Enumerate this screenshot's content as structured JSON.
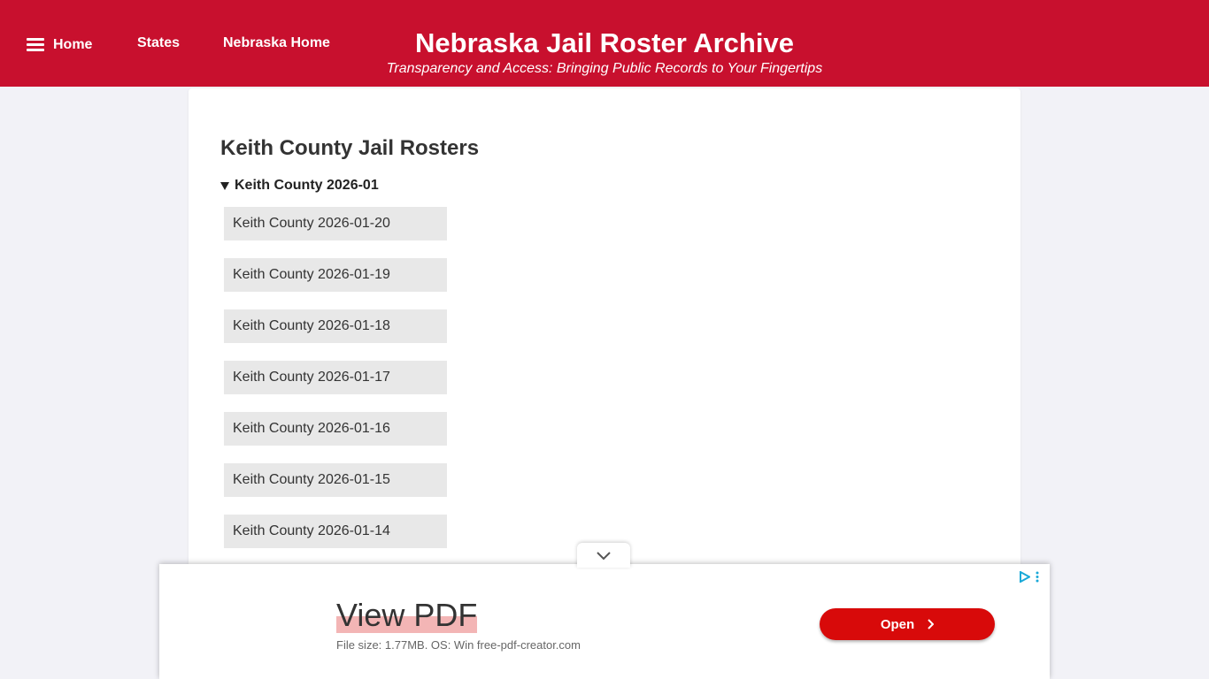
{
  "nav": {
    "home_label": "Home",
    "states_label": "States",
    "nebraska_home_label": "Nebraska Home"
  },
  "site": {
    "title": "Nebraska Jail Roster Archive",
    "subtitle": "Transparency and Access: Bringing Public Records to Your Fingertips"
  },
  "main": {
    "page_title": "Keith County Jail Rosters",
    "group_label": "Keith County 2026-01",
    "rosters": [
      "Keith County 2026-01-20",
      "Keith County 2026-01-19",
      "Keith County 2026-01-18",
      "Keith County 2026-01-17",
      "Keith County 2026-01-16",
      "Keith County 2026-01-15",
      "Keith County 2026-01-14"
    ]
  },
  "ad": {
    "headline": "View PDF",
    "description": "File size: 1.77MB. OS: Win free-pdf-creator.com",
    "button_label": "Open",
    "icons": [
      "chevron-down-icon",
      "adchoices-icon",
      "more-vert-icon",
      "chevron-right-icon",
      "menu-icon"
    ]
  },
  "colors": {
    "brand_red": "#c8102e",
    "ad_button_red": "#d80a0a",
    "link_bg": "#e8e8e8",
    "page_bg": "#f2f2f7"
  }
}
